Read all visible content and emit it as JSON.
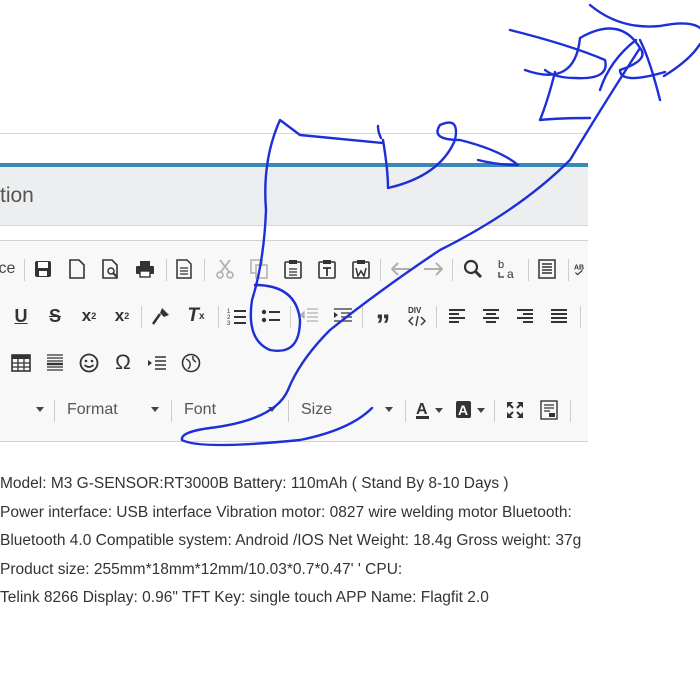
{
  "window": {
    "title_partial": "tion"
  },
  "toolbar": {
    "row1": {
      "source_label_partial": "ce"
    },
    "row4": {
      "format_label": "Format",
      "font_label": "Font",
      "size_label": "Size"
    }
  },
  "content": {
    "lines": [
      "Model: M3 G-SENSOR:RT3000B Battery: 110mAh ( Stand By 8-10 Days )",
      "Power interface: USB interface Vibration motor: 0827 wire welding motor Bluetooth:",
      "Bluetooth 4.0 Compatible system: Android /IOS Net Weight: 18.4g Gross weight: 37g",
      "Product size: 255mm*18mm*12mm/10.03*0.7*0.47' ' CPU:",
      "Telink 8266 Display: 0.96\" TFT Key: single touch APP Name: Flagfit 2.0"
    ]
  },
  "colors": {
    "accent": "#3a88b7",
    "header_bg": "#eceeef",
    "toolbar_bg": "#f8f8f8",
    "scribble": "#1d2fd6"
  },
  "icons": [
    "save-icon",
    "new-page-icon",
    "preview-icon",
    "print-icon",
    "templates-icon",
    "cut-icon",
    "copy-icon",
    "paste-icon",
    "paste-text-icon",
    "paste-word-icon",
    "undo-icon",
    "redo-icon",
    "find-icon",
    "replace-icon",
    "select-all-icon",
    "spellcheck-icon",
    "underline-icon",
    "strikethrough-icon",
    "subscript-icon",
    "superscript-icon",
    "copy-formatting-icon",
    "remove-format-icon",
    "numbered-list-icon",
    "bulleted-list-icon",
    "outdent-icon",
    "indent-icon",
    "blockquote-icon",
    "creatediv-icon",
    "align-left-icon",
    "align-center-icon",
    "align-right-icon",
    "justify-icon",
    "table-icon",
    "horizontal-line-icon",
    "smiley-icon",
    "special-char-icon",
    "page-break-icon",
    "iframe-icon",
    "text-color-icon",
    "background-color-icon",
    "maximize-icon",
    "show-blocks-icon"
  ]
}
